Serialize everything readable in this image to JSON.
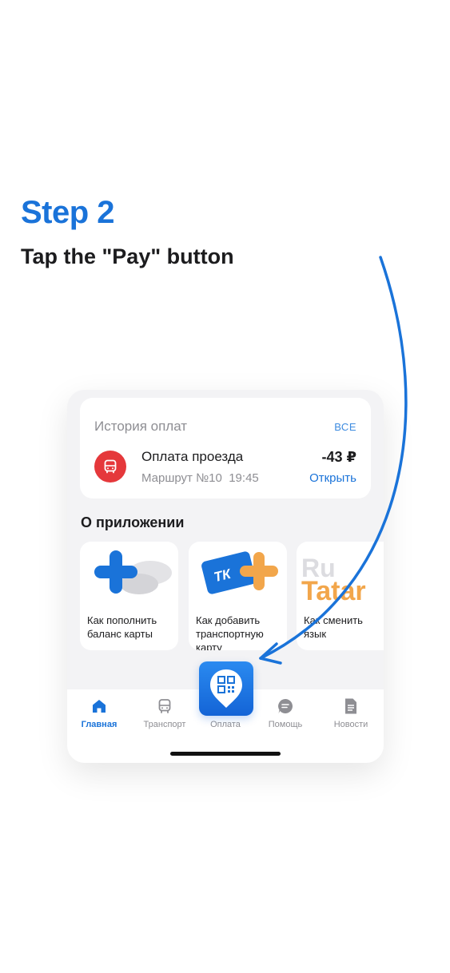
{
  "step": {
    "title": "Step 2",
    "subtitle": "Tap the \"Pay\" button"
  },
  "history": {
    "title": "История оплат",
    "all_link": "ВСЕ",
    "payment": {
      "name": "Оплата проезда",
      "route": "Маршрут №10",
      "time": "19:45",
      "amount": "-43 ₽",
      "open_link": "Открыть"
    }
  },
  "about": {
    "title": "О приложении",
    "cards": [
      {
        "label": "Как пополнить баланс карты"
      },
      {
        "label": "Как добавить транспортную карту"
      },
      {
        "label": "Как сменить язык"
      }
    ],
    "card3_art_text_top": "Ru",
    "card3_art_text_bottom": "Tatar",
    "card2_logo_text": "ТК"
  },
  "nav": {
    "items": [
      {
        "label": "Главная",
        "icon": "home-icon",
        "active": true
      },
      {
        "label": "Транспорт",
        "icon": "bus-icon",
        "active": false
      },
      {
        "label": "Оплата",
        "icon": "qr-pin-icon",
        "active": false
      },
      {
        "label": "Помощь",
        "icon": "chat-icon",
        "active": false
      },
      {
        "label": "Новости",
        "icon": "news-icon",
        "active": false
      }
    ]
  },
  "colors": {
    "accent": "#1a73d9",
    "payment_icon": "#e5383b",
    "background": "#f3f3f5"
  }
}
